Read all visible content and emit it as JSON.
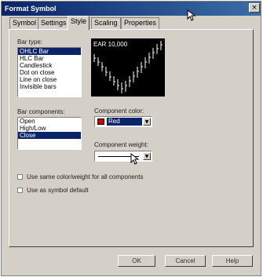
{
  "window": {
    "title": "Format Symbol",
    "close_glyph": "×"
  },
  "tabs": [
    {
      "label": "Symbol",
      "active": false
    },
    {
      "label": "Settings",
      "active": false
    },
    {
      "label": "Style",
      "active": true
    },
    {
      "label": "Scaling",
      "active": false
    },
    {
      "label": "Properties",
      "active": false
    }
  ],
  "bar_type": {
    "label": "Bar type:",
    "items": [
      "OHLC Bar",
      "HLC Bar",
      "Candlestick",
      "Dot on close",
      "Line on close",
      "Invisible bars"
    ],
    "selected_index": 0
  },
  "preview": {
    "label": "EAR 10,000"
  },
  "bar_components": {
    "label": "Bar components:",
    "items": [
      "Open",
      "High/Low",
      "Close"
    ],
    "selected_index": 2
  },
  "component_color": {
    "label": "Component color:",
    "value": "Red",
    "swatch": "#cc0000"
  },
  "component_weight": {
    "label": "Component weight:"
  },
  "options": {
    "same_color": "Use same color/weight for all components",
    "symbol_default": "Use as symbol default"
  },
  "buttons": {
    "ok": "OK",
    "cancel": "Cancel",
    "help": "Help"
  },
  "colors": {
    "selection": "#0a246a",
    "title_bar": "#0a246a",
    "face": "#d4d0c8"
  },
  "icons": [
    "close-icon",
    "chevron-down-icon",
    "mouse-cursor-icon"
  ]
}
